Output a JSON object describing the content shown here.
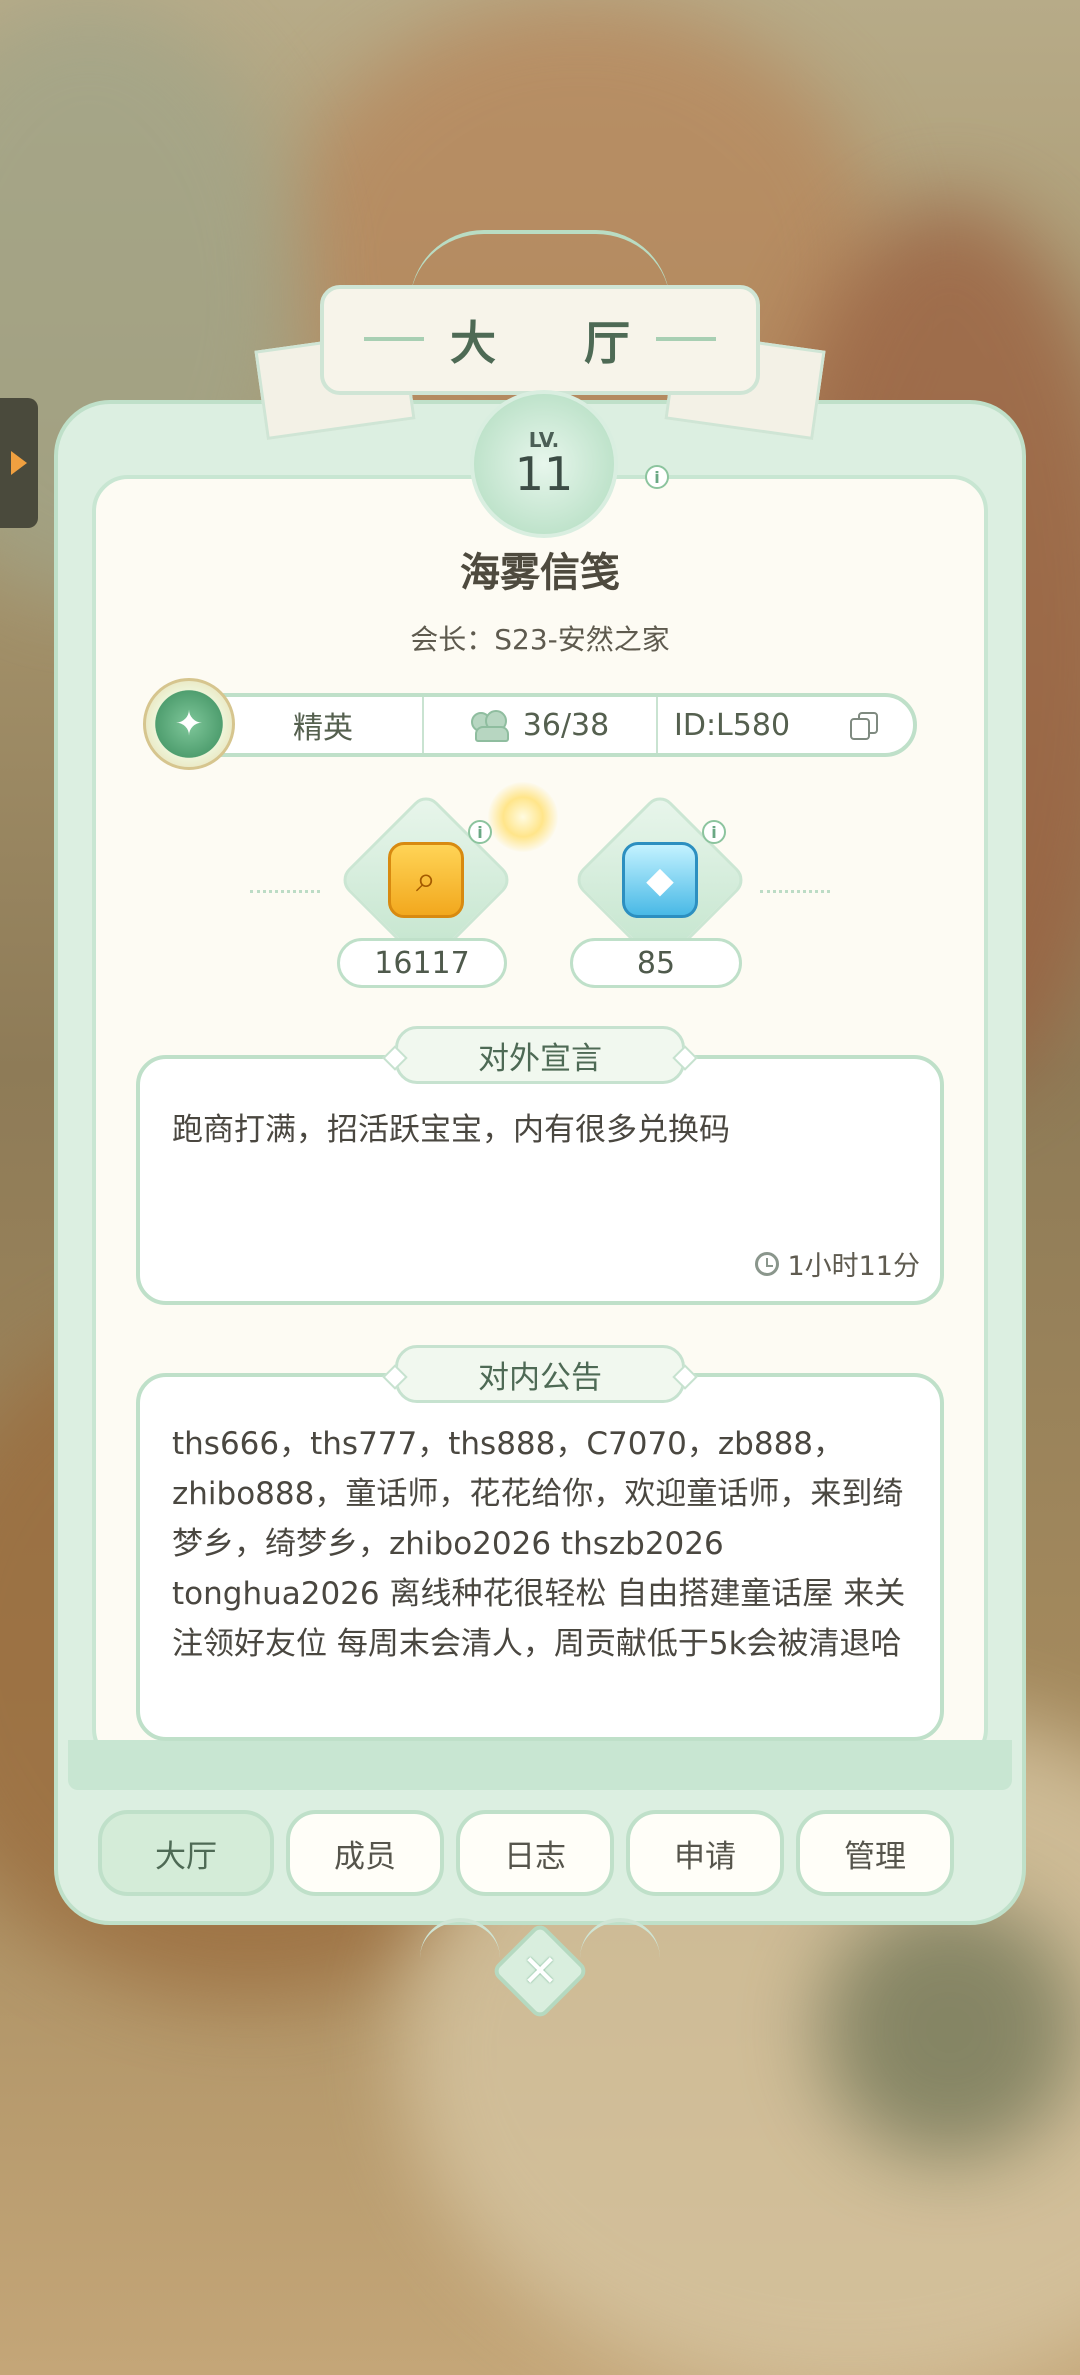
{
  "window": {
    "title": "大 厅",
    "level_label": "LV.",
    "level": "11"
  },
  "guild": {
    "name": "海雾信笺",
    "leader": "会长：S23-安然之家",
    "rank": "精英",
    "members": "36/38",
    "id": "ID:L580"
  },
  "currencies": [
    {
      "icon": "gold-resource-icon",
      "value": "16117"
    },
    {
      "icon": "blue-crystal-icon",
      "value": "85"
    }
  ],
  "declaration": {
    "title": "对外宣言",
    "text": "跑商打满，招活跃宝宝，内有很多兑换码",
    "time": "1小时11分"
  },
  "announcement": {
    "title": "对内公告",
    "text": "ths666，ths777，ths888，C7070，zb888，zhibo888，童话师，花花给你，欢迎童话师，来到绮梦乡，绮梦乡，zhibo2026 thszb2026 tonghua2026 离线种花很轻松 自由搭建童话屋 来关注领好友位 每周末会清人，周贡献低于5k会被清退哈"
  },
  "tabs": [
    {
      "label": "大厅",
      "active": true
    },
    {
      "label": "成员",
      "active": false
    },
    {
      "label": "日志",
      "active": false
    },
    {
      "label": "申请",
      "active": false
    },
    {
      "label": "管理",
      "active": false
    }
  ],
  "colors": {
    "accent": "#bfe0c9",
    "panel": "#fdfbf3",
    "active_tab": "#d4ecd8"
  },
  "icons": {
    "info": "i",
    "close": "✕"
  }
}
